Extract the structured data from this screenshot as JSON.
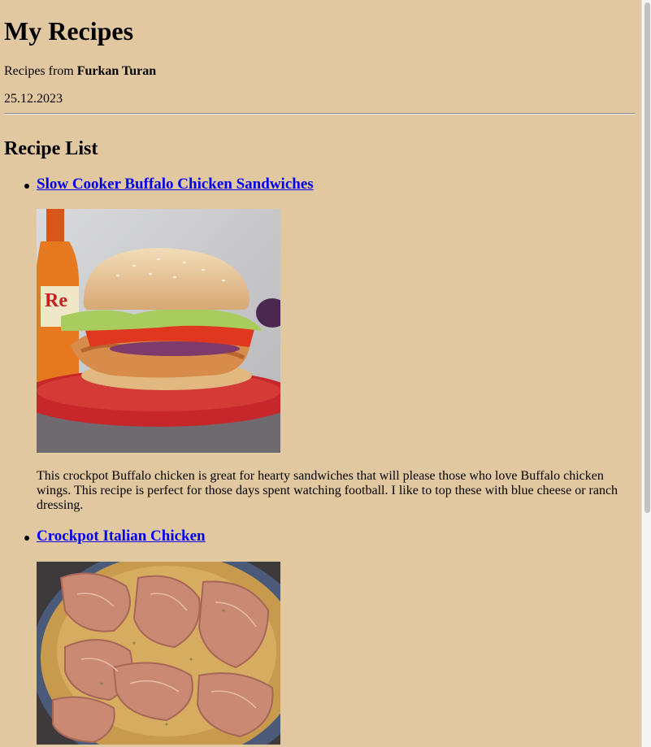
{
  "header": {
    "title": "My Recipes",
    "author_prefix": "Recipes from ",
    "author_name": "Furkan Turan",
    "date": "25.12.2023"
  },
  "recipe_list": {
    "title": "Recipe List",
    "items": [
      {
        "name": "Slow Cooker Buffalo Chicken Sandwiches",
        "image_label": "Re",
        "description": "This crockpot Buffalo chicken is great for hearty sandwiches that will please those who love Buffalo chicken wings. This recipe is perfect for those days spent watching football. I like to top these with blue cheese or ranch dressing."
      },
      {
        "name": "Crockpot Italian Chicken"
      }
    ]
  },
  "colors": {
    "background": "#e2c8a0",
    "link": "#0000ee"
  }
}
